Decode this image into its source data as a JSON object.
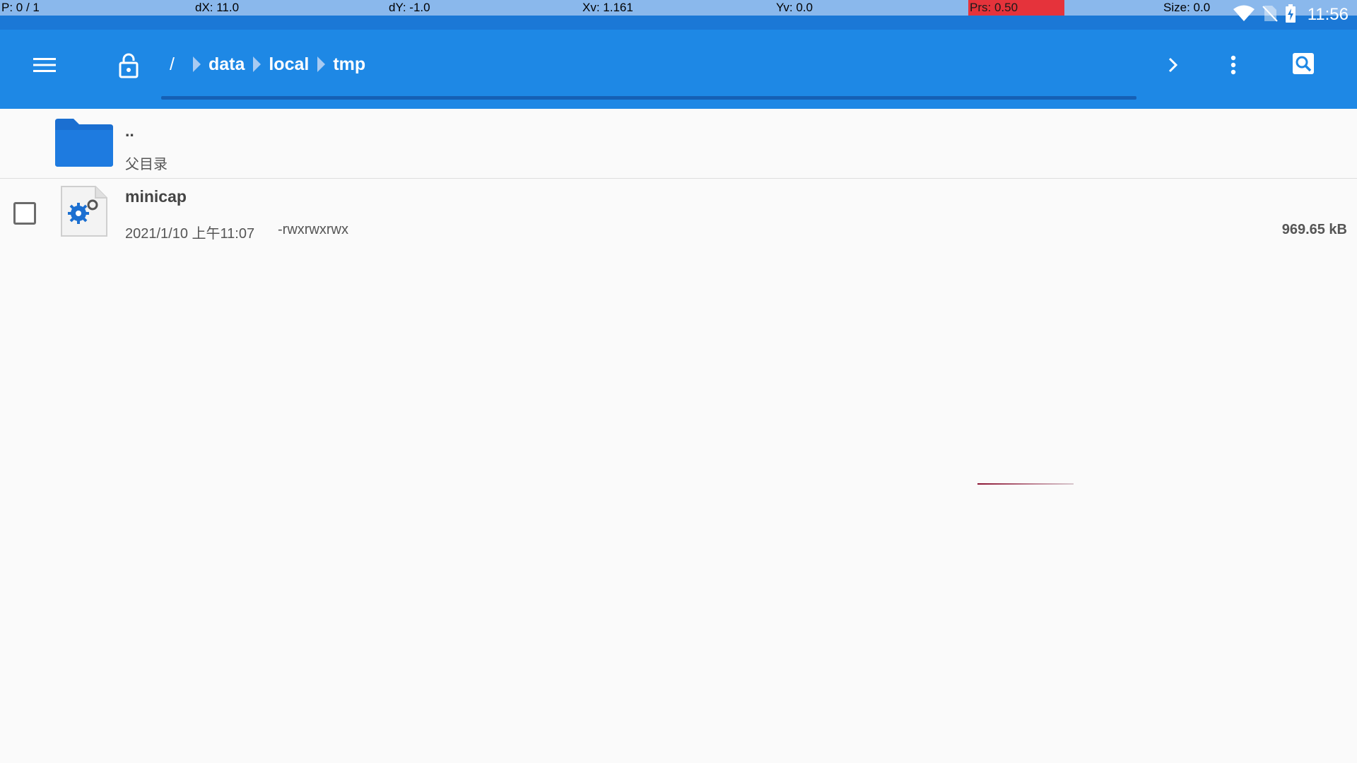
{
  "pointer_info": {
    "p": "P: 0 / 1",
    "dx": "dX: 11.0",
    "dy": "dY: -1.0",
    "xv": "Xv: 1.161",
    "yv": "Yv: 0.0",
    "prs": "Prs: 0.50",
    "size": "Size: 0.0"
  },
  "status_bar": {
    "time": "11:56",
    "icons": [
      "wifi-icon",
      "no-sim-icon",
      "battery-charging-icon"
    ]
  },
  "toolbar": {
    "menu_icon": "hamburger-menu-icon",
    "lock_icon": "unlock-icon",
    "breadcrumb": [
      "/",
      "data",
      "local",
      "tmp"
    ],
    "forward_icon": "chevron-right-icon",
    "more_icon": "more-vert-icon",
    "search_icon": "search-icon",
    "accent_color": "#1e88e5"
  },
  "files": [
    {
      "name": "..",
      "subtitle": "父目录",
      "icon": "folder-icon"
    },
    {
      "name": "minicap",
      "date": "2021/1/10 上午11:07",
      "permissions": "-rwxrwxrwx",
      "size": "969.65 kB",
      "icon": "executable-file-icon",
      "checked": false
    }
  ]
}
